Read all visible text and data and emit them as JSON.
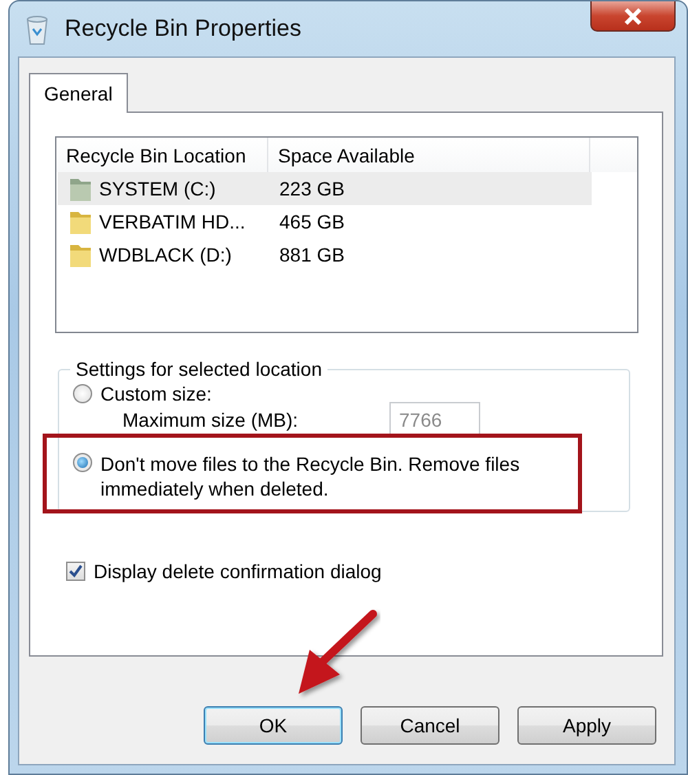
{
  "window": {
    "title": "Recycle Bin Properties"
  },
  "tabs": [
    {
      "label": "General",
      "selected": true
    }
  ],
  "locations": {
    "columns": [
      "Recycle Bin Location",
      "Space Available"
    ],
    "rows": [
      {
        "name": "SYSTEM (C:)",
        "space": "223 GB",
        "kind": "system",
        "selected": true
      },
      {
        "name": "VERBATIM HD...",
        "space": "465 GB",
        "kind": "folder",
        "selected": false
      },
      {
        "name": "WDBLACK (D:)",
        "space": "881 GB",
        "kind": "folder",
        "selected": false
      }
    ]
  },
  "settings": {
    "legend": "Settings for selected location",
    "options": [
      {
        "label": "Custom size:",
        "selected": false,
        "highlighted": false
      },
      {
        "label": "Don't move files to the Recycle Bin. Remove files immediately when deleted.",
        "selected": true,
        "highlighted": true
      }
    ],
    "max_size": {
      "label": "Maximum size (MB):",
      "value": "7766",
      "disabled": true
    }
  },
  "confirm": {
    "label": "Display delete confirmation dialog",
    "checked": true
  },
  "buttons": [
    {
      "label": "OK",
      "default": true,
      "pointed": true
    },
    {
      "label": "Cancel",
      "default": false,
      "pointed": false
    },
    {
      "label": "Apply",
      "default": false,
      "pointed": false
    }
  ]
}
